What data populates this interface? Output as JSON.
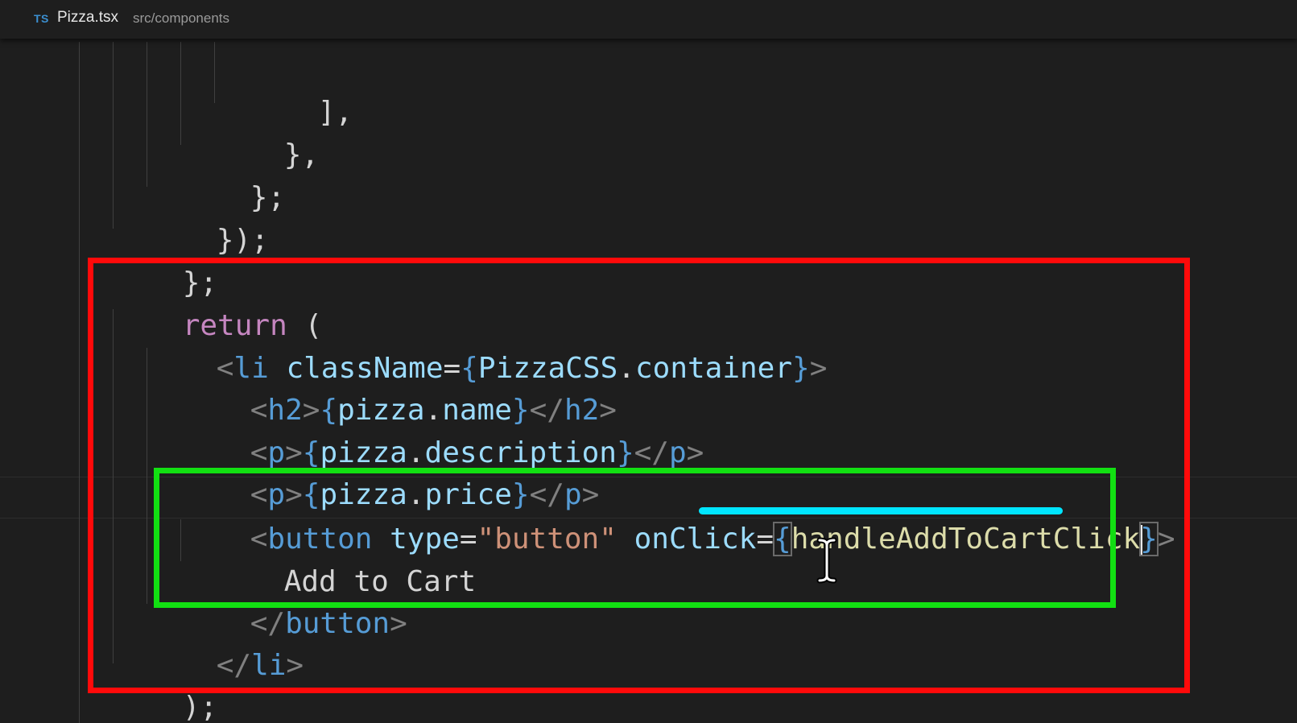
{
  "header": {
    "language_badge": "TS",
    "file_name": "Pizza.tsx",
    "file_path": "src/components"
  },
  "code": {
    "line_01": "],",
    "line_02": "},",
    "line_03": "};",
    "line_04": "});",
    "line_05": "};",
    "line_06": {
      "keyword": "return",
      "paren": "("
    },
    "line_07": {
      "open": "<",
      "tag": "li",
      "attr": "className",
      "eq": "=",
      "brace_open": "{",
      "object": "PizzaCSS",
      "dot": ".",
      "property": "container",
      "brace_close": "}",
      "close": ">"
    },
    "line_08": {
      "open": "<",
      "tag": "h2",
      "close": ">",
      "brace_open": "{",
      "object": "pizza",
      "dot": ".",
      "property": "name",
      "brace_close": "}",
      "end_open": "</",
      "end_tag": "h2",
      "end_close": ">"
    },
    "line_09": {
      "open": "<",
      "tag": "p",
      "close": ">",
      "brace_open": "{",
      "object": "pizza",
      "dot": ".",
      "property": "description",
      "brace_close": "}",
      "end_open": "</",
      "end_tag": "p",
      "end_close": ">"
    },
    "line_10": {
      "open": "<",
      "tag": "p",
      "close": ">",
      "brace_open": "{",
      "object": "pizza",
      "dot": ".",
      "property": "price",
      "brace_close": "}",
      "end_open": "</",
      "end_tag": "p",
      "end_close": ">"
    },
    "line_11": {
      "open": "<",
      "tag": "button",
      "attr_type": "type",
      "eq1": "=",
      "type_value": "\"button\"",
      "attr_onclick": "onClick",
      "eq2": "=",
      "brace_open": "{",
      "handler": "handleAddToCartClick",
      "brace_close": "}",
      "close": ">"
    },
    "line_12": "Add to Cart",
    "line_13": {
      "end_open": "</",
      "end_tag": "button",
      "end_close": ">"
    },
    "line_14": {
      "end_open": "</",
      "end_tag": "li",
      "end_close": ">"
    },
    "line_15": ");"
  },
  "colors": {
    "background": "#1e1e1e",
    "keyword": "#c586c0",
    "tag": "#569cd6",
    "attribute": "#9cdcfe",
    "string": "#ce9178",
    "function": "#dcdcaa",
    "annotation_outer": "#ff0a0a",
    "annotation_inner": "#12e012",
    "annotation_underline": "#00e5ff"
  },
  "icons": {
    "cursor": "i-beam-cursor-icon"
  }
}
